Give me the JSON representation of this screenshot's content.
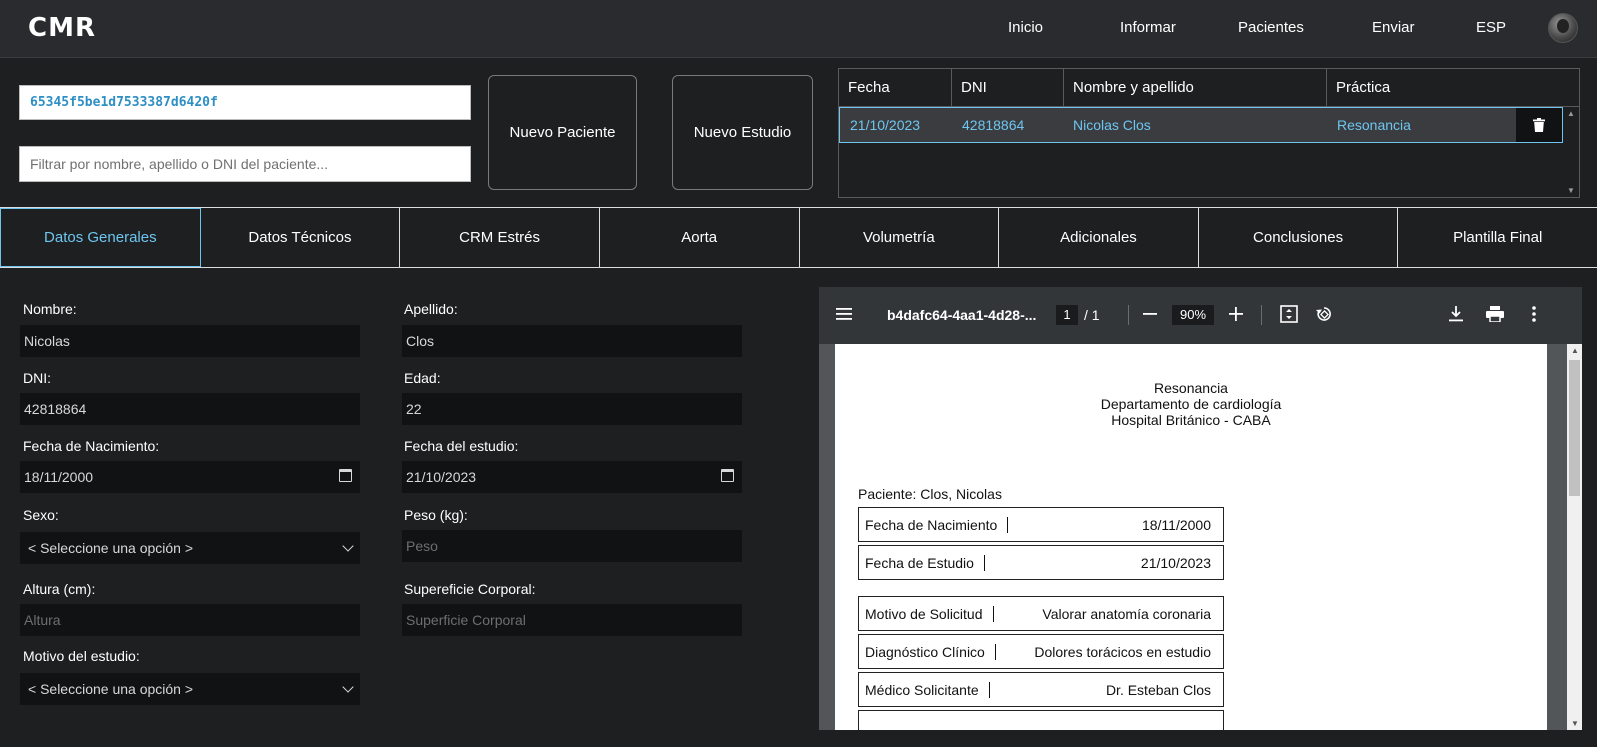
{
  "app": {
    "logo": "CMR"
  },
  "nav": {
    "inicio": "Inicio",
    "informar": "Informar",
    "pacientes": "Pacientes",
    "enviar": "Enviar",
    "lang": "ESP"
  },
  "search": {
    "study_id": "65345f5be1d7533387d6420f",
    "filter_placeholder": "Filtrar por nombre, apellido o DNI del paciente..."
  },
  "buttons": {
    "nuevo_paciente": "Nuevo Paciente",
    "nuevo_estudio": "Nuevo Estudio"
  },
  "patients_table": {
    "headers": [
      "Fecha",
      "DNI",
      "Nombre y apellido",
      "Práctica"
    ],
    "rows": [
      {
        "fecha": "21/10/2023",
        "dni": "42818864",
        "nombre": "Nicolas Clos",
        "practica": "Resonancia"
      }
    ]
  },
  "tabs": [
    "Datos Generales",
    "Datos Técnicos",
    "CRM Estrés",
    "Aorta",
    "Volumetría",
    "Adicionales",
    "Conclusiones",
    "Plantilla Final"
  ],
  "form": {
    "nombre": {
      "label": "Nombre:",
      "value": "Nicolas"
    },
    "apellido": {
      "label": "Apellido:",
      "value": "Clos"
    },
    "dni": {
      "label": "DNI:",
      "value": "42818864"
    },
    "edad": {
      "label": "Edad:",
      "value": "22"
    },
    "fecha_nac": {
      "label": "Fecha de Nacimiento:",
      "value": "18/11/2000"
    },
    "fecha_estudio": {
      "label": "Fecha del estudio:",
      "value": "21/10/2023"
    },
    "sexo": {
      "label": "Sexo:",
      "value": "< Seleccione una opción >"
    },
    "peso": {
      "label": "Peso (kg):",
      "placeholder": "Peso"
    },
    "altura": {
      "label": "Altura (cm):",
      "placeholder": "Altura"
    },
    "superficie": {
      "label": "Supereficie Corporal:",
      "placeholder": "Superficie Corporal"
    },
    "motivo": {
      "label": "Motivo del estudio:",
      "value": "< Seleccione una opción >"
    }
  },
  "pdf_viewer": {
    "title": "b4dafc64-4aa1-4d28-...",
    "page_current": "1",
    "page_sep": "/ 1",
    "zoom": "90%",
    "document": {
      "header_line1": "Resonancia",
      "header_line2": "Departamento de cardiología",
      "header_line3": "Hospital Británico - CABA",
      "patient": "Paciente: Clos, Nicolas",
      "fields": [
        {
          "key": "Fecha de Nacimiento",
          "value": "18/11/2000"
        },
        {
          "key": "Fecha de Estudio",
          "value": "21/10/2023"
        },
        {
          "key": "Motivo de Solicitud",
          "value": "Valorar anatomía coronaria"
        },
        {
          "key": "Diagnóstico Clínico",
          "value": "Dolores torácicos en estudio"
        },
        {
          "key": "Médico Solicitante",
          "value": "Dr. Esteban Clos"
        }
      ]
    }
  },
  "colors": {
    "accent": "#6ec6f0",
    "bg": "#1e1f21",
    "topbar": "#2a2b2e",
    "field_bg": "#111214"
  }
}
